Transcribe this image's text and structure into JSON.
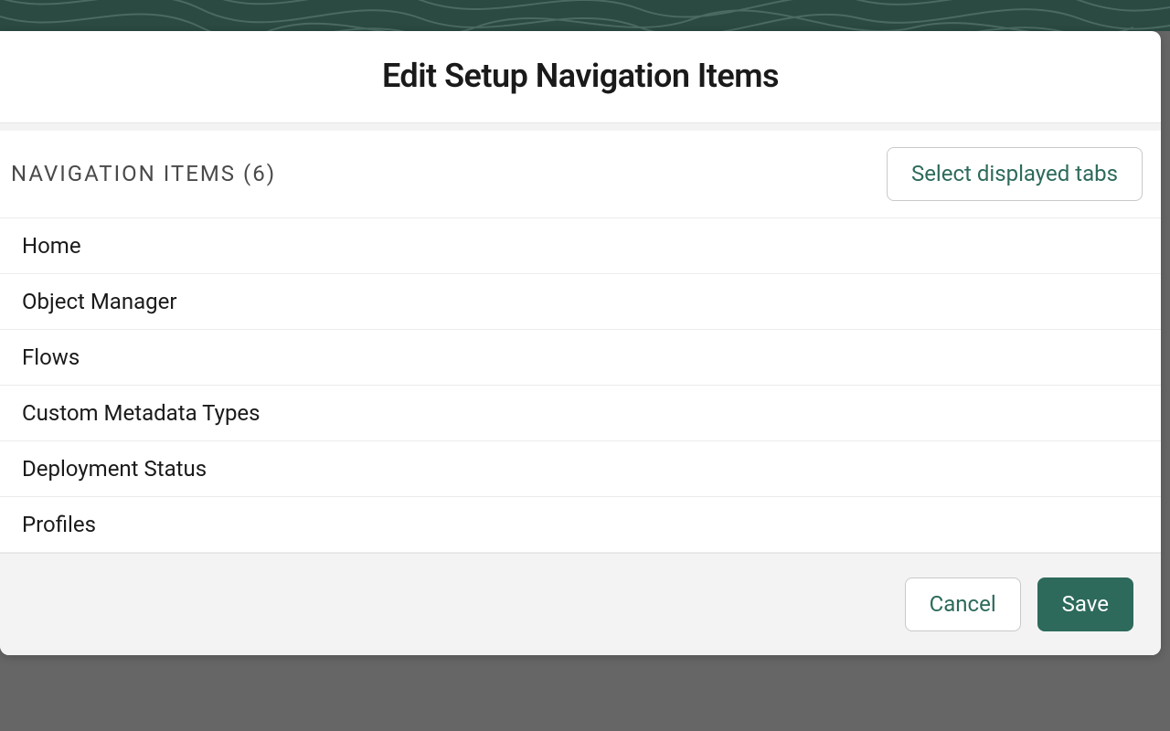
{
  "modal": {
    "title": "Edit Setup Navigation Items",
    "section_label": "NAVIGATION ITEMS (6)",
    "select_tabs_label": "Select displayed tabs",
    "items": [
      {
        "label": "Home"
      },
      {
        "label": "Object Manager"
      },
      {
        "label": "Flows"
      },
      {
        "label": "Custom Metadata Types"
      },
      {
        "label": "Deployment Status"
      },
      {
        "label": "Profiles"
      }
    ],
    "footer": {
      "cancel_label": "Cancel",
      "save_label": "Save"
    }
  },
  "colors": {
    "accent": "#2d6a5b",
    "header_bg": "#2a4a42"
  }
}
